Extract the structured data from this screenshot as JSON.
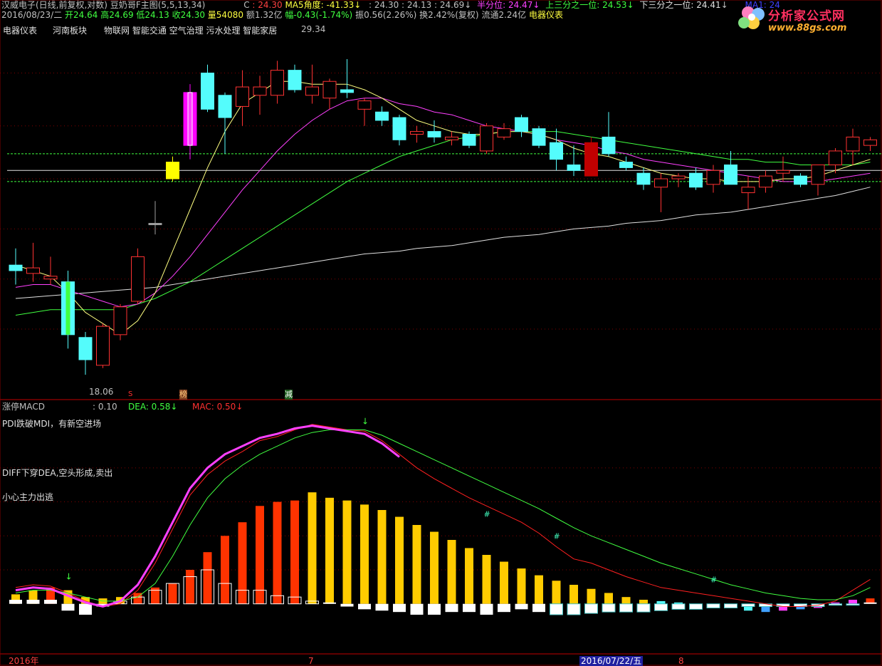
{
  "header": {
    "title": "汉威电子(日线,前复权,对数)",
    "indicator": "豆奶哥F主图(5,5,13,34)",
    "c_label": "C",
    "c_value": "24.30",
    "ma5_angle_label": "MA5角度:",
    "ma5_angle_value": "-41.33",
    "prices": ": 24.30 : 24.13 : 24.69",
    "half_label": "半分位:",
    "half_value": "24.47",
    "upper_third_label": "上三分之一位:",
    "upper_third_value": "24.53",
    "lower_third_label": "下三分之一位:",
    "lower_third_value": "24.41",
    "ma1_label": "MA1: 24"
  },
  "info_line": {
    "date": "2016/08/23/二",
    "open": "开24.64",
    "high": "高24.69",
    "low": "低24.13",
    "close": "收24.30",
    "volume": "量54080",
    "amount": "额1.32亿",
    "change": "幅-0.43(-1.74%)",
    "amplitude": "振0.56(2.26%)",
    "turnover": "换2.42%(复权)",
    "float": "流通2.24亿",
    "sector": "电器仪表"
  },
  "tags": [
    "电器仪表",
    "河南板块",
    "物联网 智能交通 空气治理 污水处理 智能家居"
  ],
  "annotations": {
    "high_price": "29.34",
    "low_price": "18.06",
    "marker_s": "S",
    "marker_bang": "榜",
    "marker_jian": "减"
  },
  "macd_panel": {
    "title": "涨停MACD",
    "value": ": 0.10",
    "dea_label": "DEA: 0.58",
    "mac_label": "MAC: 0.50",
    "text1": "PDI跌破MDI，有新空进场",
    "text2": "DIFF下穿DEA,空头形成,卖出",
    "text3": "小心主力出逃"
  },
  "xaxis": {
    "year": "2016年",
    "m7": "7",
    "date_box": "2016/07/22/五",
    "m8": "8"
  },
  "logo": {
    "name": "分析家公式网",
    "url": "www.88gs.com"
  },
  "colors": {
    "up": "#ff3232",
    "down": "#54fcfc",
    "ma5": "#ffff80",
    "ma13": "#ff40ff",
    "ma34": "#40ff40",
    "ma60": "#e0e0e0",
    "macd_bar_red": "#ff3300",
    "macd_bar_yellow": "#ffcc00"
  },
  "chart_data": {
    "type": "candlestick",
    "price_range": [
      17.5,
      30.5
    ],
    "candles": [
      {
        "o": 22.0,
        "h": 22.6,
        "l": 21.3,
        "c": 21.8,
        "color": "cyan"
      },
      {
        "o": 21.9,
        "h": 22.8,
        "l": 21.4,
        "c": 21.7,
        "color": "red"
      },
      {
        "o": 21.6,
        "h": 22.3,
        "l": 21.3,
        "c": 21.5,
        "color": "red"
      },
      {
        "o": 21.4,
        "h": 21.8,
        "l": 19.0,
        "c": 19.5,
        "color": "cyanfill"
      },
      {
        "o": 19.4,
        "h": 19.6,
        "l": 18.06,
        "c": 18.6,
        "color": "cyan"
      },
      {
        "o": 18.4,
        "h": 19.9,
        "l": 18.3,
        "c": 19.8,
        "color": "red"
      },
      {
        "o": 19.5,
        "h": 20.6,
        "l": 19.3,
        "c": 20.5,
        "color": "red"
      },
      {
        "o": 20.7,
        "h": 22.6,
        "l": 20.6,
        "c": 22.3,
        "color": "red"
      },
      {
        "o": 23.5,
        "h": 24.3,
        "l": 23.1,
        "c": 23.5,
        "color": "gray"
      },
      {
        "o": 25.7,
        "h": 25.9,
        "l": 25.0,
        "c": 25.1,
        "color": "yellow"
      },
      {
        "o": 26.3,
        "h": 28.5,
        "l": 25.8,
        "c": 28.2,
        "color": "magenta"
      },
      {
        "o": 27.6,
        "h": 29.2,
        "l": 27.5,
        "c": 28.9,
        "color": "cyan"
      },
      {
        "o": 28.1,
        "h": 28.2,
        "l": 26.0,
        "c": 27.3,
        "color": "cyan"
      },
      {
        "o": 27.7,
        "h": 29.0,
        "l": 27.0,
        "c": 28.4,
        "color": "red"
      },
      {
        "o": 28.1,
        "h": 28.8,
        "l": 27.4,
        "c": 28.4,
        "color": "red"
      },
      {
        "o": 28.1,
        "h": 29.34,
        "l": 27.8,
        "c": 29.0,
        "color": "red"
      },
      {
        "o": 29.0,
        "h": 29.2,
        "l": 28.2,
        "c": 28.3,
        "color": "cyan"
      },
      {
        "o": 28.4,
        "h": 29.2,
        "l": 27.8,
        "c": 28.1,
        "color": "red"
      },
      {
        "o": 28.0,
        "h": 28.7,
        "l": 27.6,
        "c": 28.6,
        "color": "red"
      },
      {
        "o": 28.3,
        "h": 29.4,
        "l": 28.0,
        "c": 28.2,
        "color": "cyan"
      },
      {
        "o": 27.9,
        "h": 28.0,
        "l": 27.0,
        "c": 27.6,
        "color": "red"
      },
      {
        "o": 27.5,
        "h": 27.7,
        "l": 27.0,
        "c": 27.2,
        "color": "cyan"
      },
      {
        "o": 27.3,
        "h": 27.4,
        "l": 26.3,
        "c": 26.5,
        "color": "cyan"
      },
      {
        "o": 26.7,
        "h": 27.0,
        "l": 26.4,
        "c": 26.8,
        "color": "red"
      },
      {
        "o": 26.8,
        "h": 27.2,
        "l": 26.4,
        "c": 26.6,
        "color": "cyan"
      },
      {
        "o": 26.5,
        "h": 26.8,
        "l": 26.3,
        "c": 26.6,
        "color": "red"
      },
      {
        "o": 26.7,
        "h": 26.8,
        "l": 26.2,
        "c": 26.3,
        "color": "cyan"
      },
      {
        "o": 26.1,
        "h": 27.1,
        "l": 26.0,
        "c": 27.0,
        "color": "red"
      },
      {
        "o": 26.6,
        "h": 27.1,
        "l": 26.5,
        "c": 26.9,
        "color": "red"
      },
      {
        "o": 27.3,
        "h": 27.4,
        "l": 26.6,
        "c": 26.8,
        "color": "cyan"
      },
      {
        "o": 26.9,
        "h": 27.0,
        "l": 26.2,
        "c": 26.3,
        "color": "cyan"
      },
      {
        "o": 26.4,
        "h": 26.9,
        "l": 25.4,
        "c": 25.8,
        "color": "cyan"
      },
      {
        "o": 25.6,
        "h": 26.3,
        "l": 25.2,
        "c": 25.4,
        "color": "cyan"
      },
      {
        "o": 25.2,
        "h": 26.6,
        "l": 25.2,
        "c": 26.4,
        "color": "darkred"
      },
      {
        "o": 26.6,
        "h": 27.5,
        "l": 25.9,
        "c": 26.0,
        "color": "cyan"
      },
      {
        "o": 25.7,
        "h": 25.9,
        "l": 25.4,
        "c": 25.5,
        "color": "cyan"
      },
      {
        "o": 25.3,
        "h": 25.5,
        "l": 24.7,
        "c": 24.9,
        "color": "cyan"
      },
      {
        "o": 24.8,
        "h": 25.3,
        "l": 23.9,
        "c": 25.1,
        "color": "red"
      },
      {
        "o": 25.1,
        "h": 25.3,
        "l": 24.8,
        "c": 25.2,
        "color": "red"
      },
      {
        "o": 25.3,
        "h": 25.5,
        "l": 24.7,
        "c": 24.8,
        "color": "cyan"
      },
      {
        "o": 24.9,
        "h": 25.6,
        "l": 24.6,
        "c": 25.4,
        "color": "red"
      },
      {
        "o": 25.6,
        "h": 26.1,
        "l": 24.9,
        "c": 24.9,
        "color": "cyan"
      },
      {
        "o": 24.6,
        "h": 25.2,
        "l": 24.0,
        "c": 24.8,
        "color": "red"
      },
      {
        "o": 24.8,
        "h": 25.4,
        "l": 24.6,
        "c": 25.2,
        "color": "red"
      },
      {
        "o": 25.3,
        "h": 25.9,
        "l": 25.0,
        "c": 25.4,
        "color": "red"
      },
      {
        "o": 25.2,
        "h": 25.3,
        "l": 24.8,
        "c": 24.9,
        "color": "cyan"
      },
      {
        "o": 24.9,
        "h": 25.6,
        "l": 24.5,
        "c": 25.6,
        "color": "red"
      },
      {
        "o": 25.6,
        "h": 26.2,
        "l": 25.3,
        "c": 26.1,
        "color": "red"
      },
      {
        "o": 26.1,
        "h": 26.9,
        "l": 25.6,
        "c": 26.6,
        "color": "red"
      },
      {
        "o": 26.5,
        "h": 26.6,
        "l": 26.1,
        "c": 26.3,
        "color": "red"
      }
    ],
    "ma5": [
      22.0,
      21.8,
      21.6,
      21.0,
      20.3,
      19.9,
      19.5,
      20.0,
      21.0,
      22.5,
      24.0,
      25.5,
      26.8,
      27.8,
      28.2,
      28.6,
      28.6,
      28.5,
      28.5,
      28.5,
      28.3,
      28.0,
      27.6,
      27.2,
      27.0,
      26.8,
      26.7,
      26.7,
      26.8,
      26.8,
      26.7,
      26.5,
      26.2,
      26.0,
      25.9,
      25.7,
      25.5,
      25.3,
      25.2,
      25.1,
      25.1,
      25.0,
      25.0,
      25.0,
      25.1,
      25.1,
      25.2,
      25.4,
      25.6,
      25.8
    ],
    "ma13": [
      21.2,
      21.3,
      21.3,
      21.1,
      20.9,
      20.7,
      20.5,
      20.6,
      21.0,
      21.6,
      22.3,
      23.1,
      23.9,
      24.7,
      25.4,
      26.1,
      26.7,
      27.2,
      27.6,
      27.9,
      28.0,
      28.0,
      27.8,
      27.7,
      27.5,
      27.4,
      27.2,
      27.0,
      26.9,
      26.8,
      26.7,
      26.5,
      26.4,
      26.3,
      26.1,
      26.0,
      25.8,
      25.7,
      25.6,
      25.5,
      25.4,
      25.3,
      25.2,
      25.1,
      25.0,
      25.0,
      25.0,
      25.1,
      25.2,
      25.3
    ],
    "ma34": [
      20.2,
      20.3,
      20.4,
      20.4,
      20.4,
      20.4,
      20.4,
      20.6,
      20.8,
      21.1,
      21.4,
      21.8,
      22.2,
      22.6,
      23.0,
      23.4,
      23.8,
      24.2,
      24.6,
      25.0,
      25.3,
      25.6,
      25.9,
      26.1,
      26.3,
      26.5,
      26.6,
      26.7,
      26.8,
      26.8,
      26.8,
      26.8,
      26.7,
      26.6,
      26.5,
      26.4,
      26.3,
      26.2,
      26.1,
      26.0,
      25.9,
      25.8,
      25.8,
      25.7,
      25.7,
      25.6,
      25.6,
      25.6,
      25.6,
      25.7
    ],
    "ma60": [
      20.8,
      20.85,
      20.9,
      20.95,
      21.0,
      21.05,
      21.1,
      21.15,
      21.2,
      21.3,
      21.4,
      21.5,
      21.6,
      21.7,
      21.8,
      21.9,
      22.0,
      22.1,
      22.2,
      22.3,
      22.4,
      22.45,
      22.5,
      22.6,
      22.65,
      22.7,
      22.8,
      22.9,
      23.0,
      23.05,
      23.1,
      23.2,
      23.3,
      23.35,
      23.4,
      23.5,
      23.55,
      23.6,
      23.7,
      23.8,
      23.85,
      23.9,
      24.0,
      24.1,
      24.2,
      24.3,
      24.4,
      24.5,
      24.65,
      24.8
    ],
    "levels": [
      26.0,
      25.4,
      25.0
    ],
    "macd": {
      "range": [
        -0.3,
        1.35
      ],
      "diff": [
        0.12,
        0.14,
        0.13,
        0.08,
        0.02,
        -0.02,
        0.0,
        0.1,
        0.3,
        0.55,
        0.8,
        0.95,
        1.05,
        1.12,
        1.2,
        1.23,
        1.28,
        1.32,
        1.3,
        1.28,
        1.27,
        1.2,
        1.1,
        1.0,
        0.92,
        0.85,
        0.78,
        0.72,
        0.66,
        0.6,
        0.52,
        0.42,
        0.33,
        0.3,
        0.25,
        0.2,
        0.16,
        0.12,
        0.1,
        0.08,
        0.06,
        0.04,
        0.02,
        0.0,
        -0.02,
        -0.02,
        -0.01,
        0.02,
        0.1,
        0.18
      ],
      "dea": [
        0.08,
        0.1,
        0.1,
        0.08,
        0.05,
        0.02,
        0.02,
        0.05,
        0.15,
        0.35,
        0.58,
        0.78,
        0.92,
        1.02,
        1.1,
        1.16,
        1.22,
        1.26,
        1.28,
        1.28,
        1.28,
        1.24,
        1.18,
        1.12,
        1.06,
        1.0,
        0.94,
        0.88,
        0.82,
        0.76,
        0.7,
        0.63,
        0.56,
        0.5,
        0.45,
        0.4,
        0.35,
        0.3,
        0.26,
        0.22,
        0.18,
        0.14,
        0.11,
        0.08,
        0.06,
        0.04,
        0.03,
        0.03,
        0.06,
        0.12
      ],
      "pink": [
        0.1,
        0.12,
        0.11,
        0.06,
        0.01,
        -0.02,
        0.02,
        0.14,
        0.35,
        0.6,
        0.85,
        1.0,
        1.1,
        1.16,
        1.22,
        1.25,
        1.29,
        1.31,
        1.29,
        1.27,
        1.25,
        1.18,
        1.08
      ],
      "bars": [
        0.07,
        0.1,
        0.12,
        0.1,
        0.05,
        0.04,
        0.05,
        0.08,
        0.12,
        0.15,
        0.25,
        0.38,
        0.5,
        0.6,
        0.72,
        0.75,
        0.76,
        0.82,
        0.78,
        0.76,
        0.73,
        0.69,
        0.64,
        0.58,
        0.53,
        0.47,
        0.41,
        0.36,
        0.31,
        0.26,
        0.21,
        0.17,
        0.14,
        0.11,
        0.08,
        0.05,
        0.03,
        0.02,
        0.01,
        -0.01,
        -0.02,
        -0.03,
        -0.05,
        -0.06,
        -0.05,
        -0.04,
        -0.03,
        0.01,
        0.03,
        0.04
      ],
      "bar_colors": [
        "yellow",
        "yellow",
        "red",
        "yellow",
        "yellow",
        "yellow",
        "yellow",
        "red",
        "red",
        "red",
        "red",
        "red",
        "red",
        "red",
        "red",
        "red",
        "red",
        "yellow",
        "yellow",
        "yellow",
        "yellow",
        "yellow",
        "yellow",
        "yellow",
        "yellow",
        "yellow",
        "yellow",
        "yellow",
        "yellow",
        "yellow",
        "yellow",
        "yellow",
        "yellow",
        "yellow",
        "yellow",
        "yellow",
        "yellow",
        "cyan",
        "cyan",
        "cyan",
        "cyan",
        "cyan",
        "cyan",
        "blue",
        "magenta",
        "blue",
        "magenta",
        "magenta",
        "magenta",
        "red"
      ],
      "white_bars": [
        0.03,
        0.03,
        0.03,
        -0.05,
        -0.08,
        -0.02,
        0.02,
        0.05,
        0.1,
        0.15,
        0.2,
        0.25,
        0.15,
        0.1,
        0.1,
        0.06,
        0.05,
        0.02,
        0.01,
        -0.02,
        -0.04,
        -0.05,
        -0.06,
        -0.08,
        -0.08,
        -0.06,
        -0.06,
        -0.08,
        -0.06,
        -0.04,
        -0.06,
        -0.08,
        -0.08,
        -0.07,
        -0.06,
        -0.06,
        -0.06,
        -0.05,
        -0.04,
        -0.04,
        -0.03,
        -0.03,
        -0.02,
        -0.02,
        -0.02,
        -0.02,
        -0.02,
        -0.01,
        -0.01,
        0.01
      ]
    }
  }
}
